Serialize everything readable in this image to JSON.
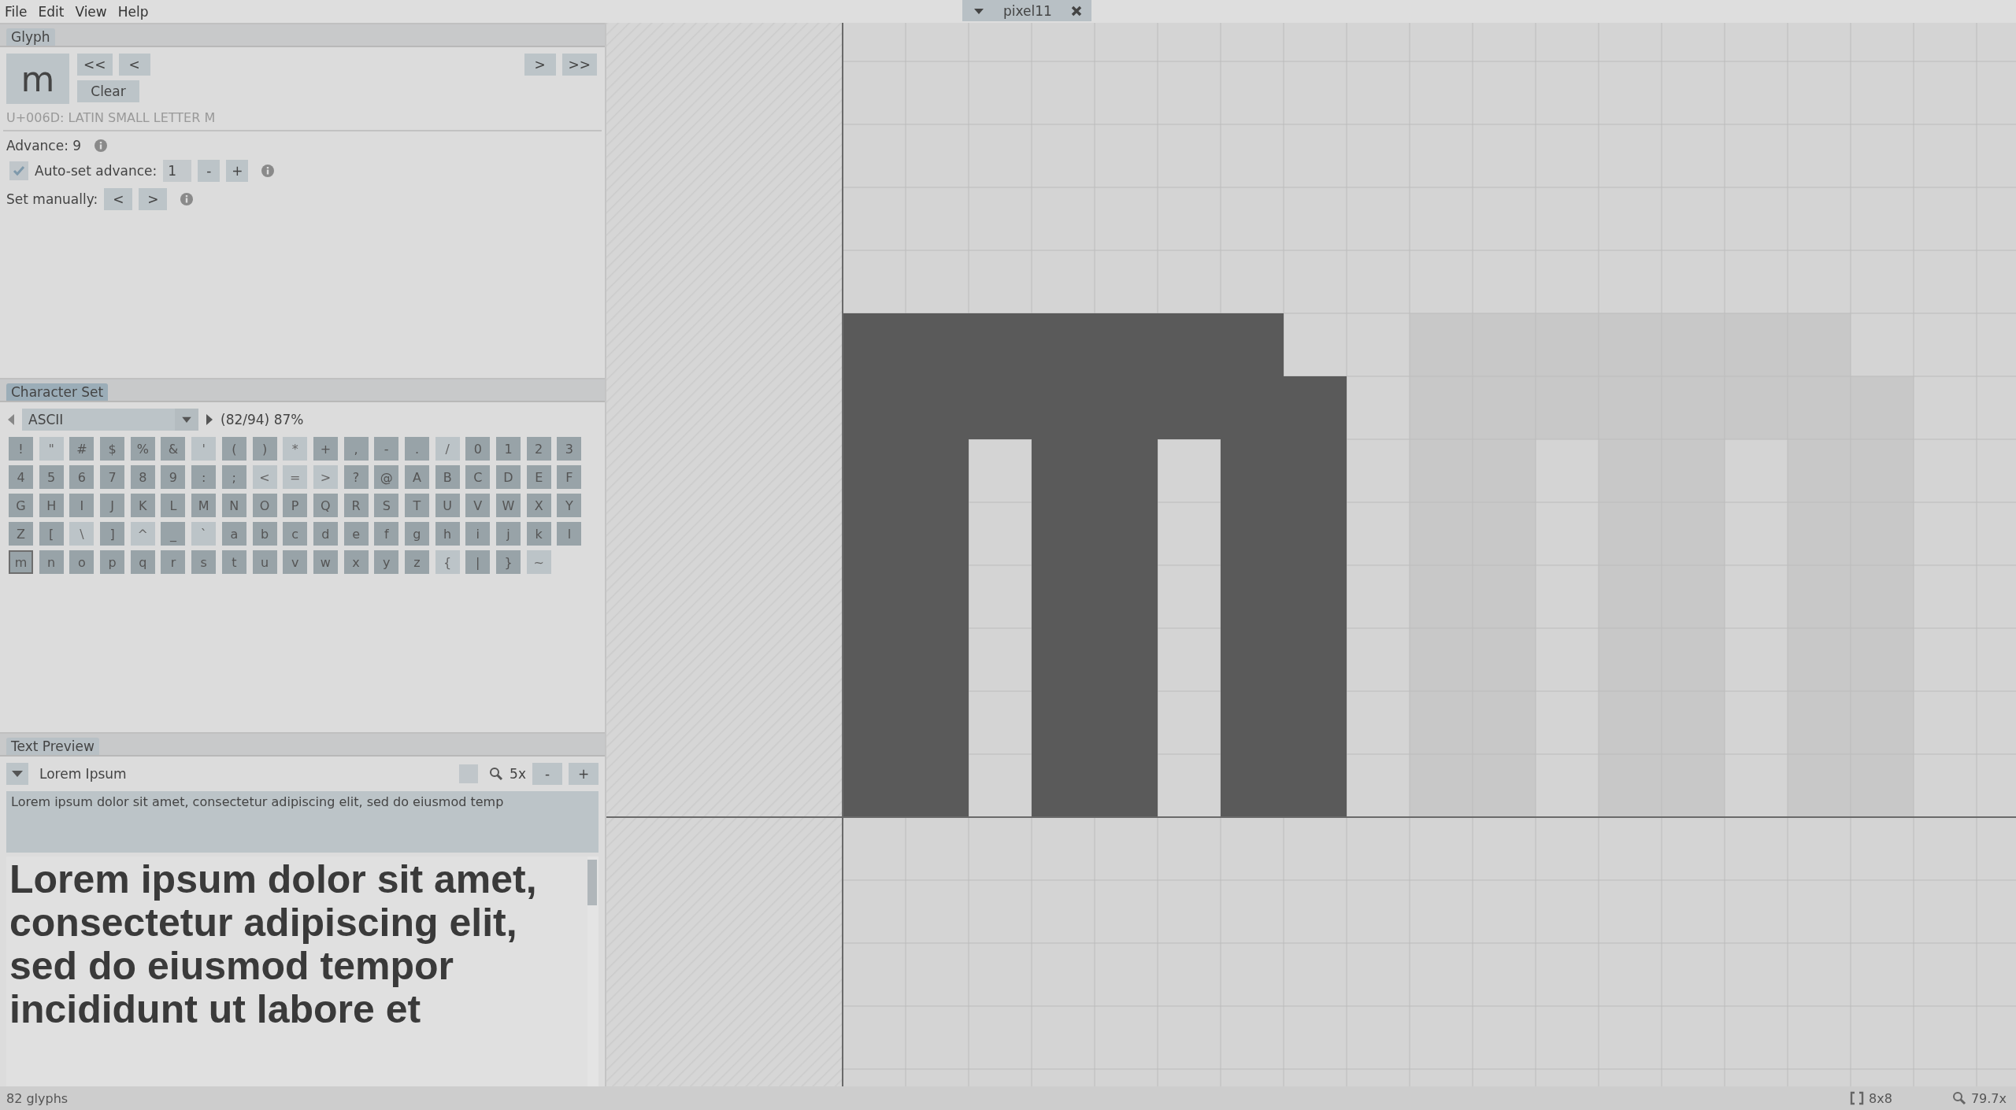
{
  "menu": [
    "File",
    "Edit",
    "View",
    "Help"
  ],
  "document_tab": {
    "title": "pixel11"
  },
  "glyph_panel": {
    "tab": "Glyph",
    "focused": false,
    "preview_char": "m",
    "nav_left": [
      "<<",
      "<"
    ],
    "nav_right": [
      ">",
      ">>"
    ],
    "clear_button": "Clear",
    "unicode_name": "U+006D: LATIN SMALL LETTER M",
    "advance_label": "Advance: 9",
    "auto_advance": {
      "label": "Auto-set advance:",
      "checked": true,
      "value": "1",
      "buttons": [
        "-",
        "+"
      ]
    },
    "set_manually": {
      "label": "Set manually:",
      "buttons": [
        "<",
        ">"
      ]
    }
  },
  "character_set_panel": {
    "tab": "Character Set",
    "focused": true,
    "set_name": "ASCII",
    "coverage": "(82/94) 87%",
    "characters": [
      {
        "char": "!",
        "defined": true,
        "selected": false
      },
      {
        "char": "\"",
        "defined": false,
        "selected": false
      },
      {
        "char": "#",
        "defined": true,
        "selected": false
      },
      {
        "char": "$",
        "defined": true,
        "selected": false
      },
      {
        "char": "%",
        "defined": true,
        "selected": false
      },
      {
        "char": "&",
        "defined": true,
        "selected": false
      },
      {
        "char": "'",
        "defined": false,
        "selected": false
      },
      {
        "char": "(",
        "defined": true,
        "selected": false
      },
      {
        "char": ")",
        "defined": true,
        "selected": false
      },
      {
        "char": "*",
        "defined": false,
        "selected": false
      },
      {
        "char": "+",
        "defined": true,
        "selected": false
      },
      {
        "char": ",",
        "defined": true,
        "selected": false
      },
      {
        "char": "-",
        "defined": true,
        "selected": false
      },
      {
        "char": ".",
        "defined": true,
        "selected": false
      },
      {
        "char": "/",
        "defined": false,
        "selected": false
      },
      {
        "char": "0",
        "defined": true,
        "selected": false
      },
      {
        "char": "1",
        "defined": true,
        "selected": false
      },
      {
        "char": "2",
        "defined": true,
        "selected": false
      },
      {
        "char": "3",
        "defined": true,
        "selected": false
      },
      {
        "char": "4",
        "defined": true,
        "selected": false
      },
      {
        "char": "5",
        "defined": true,
        "selected": false
      },
      {
        "char": "6",
        "defined": true,
        "selected": false
      },
      {
        "char": "7",
        "defined": true,
        "selected": false
      },
      {
        "char": "8",
        "defined": true,
        "selected": false
      },
      {
        "char": "9",
        "defined": true,
        "selected": false
      },
      {
        "char": ":",
        "defined": true,
        "selected": false
      },
      {
        "char": ";",
        "defined": true,
        "selected": false
      },
      {
        "char": "<",
        "defined": false,
        "selected": false
      },
      {
        "char": "=",
        "defined": false,
        "selected": false
      },
      {
        "char": ">",
        "defined": false,
        "selected": false
      },
      {
        "char": "?",
        "defined": true,
        "selected": false
      },
      {
        "char": "@",
        "defined": true,
        "selected": false
      },
      {
        "char": "A",
        "defined": true,
        "selected": false
      },
      {
        "char": "B",
        "defined": true,
        "selected": false
      },
      {
        "char": "C",
        "defined": true,
        "selected": false
      },
      {
        "char": "D",
        "defined": true,
        "selected": false
      },
      {
        "char": "E",
        "defined": true,
        "selected": false
      },
      {
        "char": "F",
        "defined": true,
        "selected": false
      },
      {
        "char": "G",
        "defined": true,
        "selected": false
      },
      {
        "char": "H",
        "defined": true,
        "selected": false
      },
      {
        "char": "I",
        "defined": true,
        "selected": false
      },
      {
        "char": "J",
        "defined": true,
        "selected": false
      },
      {
        "char": "K",
        "defined": true,
        "selected": false
      },
      {
        "char": "L",
        "defined": true,
        "selected": false
      },
      {
        "char": "M",
        "defined": true,
        "selected": false
      },
      {
        "char": "N",
        "defined": true,
        "selected": false
      },
      {
        "char": "O",
        "defined": true,
        "selected": false
      },
      {
        "char": "P",
        "defined": true,
        "selected": false
      },
      {
        "char": "Q",
        "defined": true,
        "selected": false
      },
      {
        "char": "R",
        "defined": true,
        "selected": false
      },
      {
        "char": "S",
        "defined": true,
        "selected": false
      },
      {
        "char": "T",
        "defined": true,
        "selected": false
      },
      {
        "char": "U",
        "defined": true,
        "selected": false
      },
      {
        "char": "V",
        "defined": true,
        "selected": false
      },
      {
        "char": "W",
        "defined": true,
        "selected": false
      },
      {
        "char": "X",
        "defined": true,
        "selected": false
      },
      {
        "char": "Y",
        "defined": true,
        "selected": false
      },
      {
        "char": "Z",
        "defined": true,
        "selected": false
      },
      {
        "char": "[",
        "defined": true,
        "selected": false
      },
      {
        "char": "\\",
        "defined": false,
        "selected": false
      },
      {
        "char": "]",
        "defined": true,
        "selected": false
      },
      {
        "char": "^",
        "defined": false,
        "selected": false
      },
      {
        "char": "_",
        "defined": true,
        "selected": false
      },
      {
        "char": "`",
        "defined": false,
        "selected": false
      },
      {
        "char": "a",
        "defined": true,
        "selected": false
      },
      {
        "char": "b",
        "defined": true,
        "selected": false
      },
      {
        "char": "c",
        "defined": true,
        "selected": false
      },
      {
        "char": "d",
        "defined": true,
        "selected": false
      },
      {
        "char": "e",
        "defined": true,
        "selected": false
      },
      {
        "char": "f",
        "defined": true,
        "selected": false
      },
      {
        "char": "g",
        "defined": true,
        "selected": false
      },
      {
        "char": "h",
        "defined": true,
        "selected": false
      },
      {
        "char": "i",
        "defined": true,
        "selected": false
      },
      {
        "char": "j",
        "defined": true,
        "selected": false
      },
      {
        "char": "k",
        "defined": true,
        "selected": false
      },
      {
        "char": "l",
        "defined": true,
        "selected": false
      },
      {
        "char": "m",
        "defined": true,
        "selected": true
      },
      {
        "char": "n",
        "defined": true,
        "selected": false
      },
      {
        "char": "o",
        "defined": true,
        "selected": false
      },
      {
        "char": "p",
        "defined": true,
        "selected": false
      },
      {
        "char": "q",
        "defined": true,
        "selected": false
      },
      {
        "char": "r",
        "defined": true,
        "selected": false
      },
      {
        "char": "s",
        "defined": true,
        "selected": false
      },
      {
        "char": "t",
        "defined": true,
        "selected": false
      },
      {
        "char": "u",
        "defined": true,
        "selected": false
      },
      {
        "char": "v",
        "defined": true,
        "selected": false
      },
      {
        "char": "w",
        "defined": true,
        "selected": false
      },
      {
        "char": "x",
        "defined": true,
        "selected": false
      },
      {
        "char": "y",
        "defined": true,
        "selected": false
      },
      {
        "char": "z",
        "defined": true,
        "selected": false
      },
      {
        "char": "{",
        "defined": false,
        "selected": false
      },
      {
        "char": "|",
        "defined": true,
        "selected": false
      },
      {
        "char": "}",
        "defined": true,
        "selected": false
      },
      {
        "char": "~",
        "defined": false,
        "selected": false
      }
    ]
  },
  "text_preview_panel": {
    "tab": "Text Preview",
    "focused": false,
    "sample_name": "Lorem Ipsum",
    "zoom": "5x",
    "zoom_buttons": [
      "-",
      "+"
    ],
    "text": "Lorem ipsum dolor sit amet, consectetur adipiscing elit, sed do eiusmod temp",
    "preview": "Lorem ipsum dolor sit amet, consectetur adipiscing elit, sed do eiusmod tempor incididunt ut labore et"
  },
  "status_bar": {
    "glyph_count": "82 glyphs",
    "grid_size": "8x8",
    "zoom": "79.7x"
  }
}
